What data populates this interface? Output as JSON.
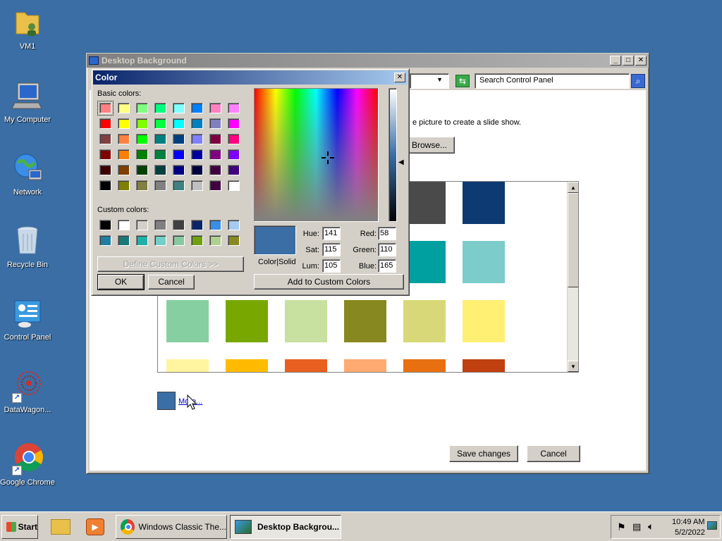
{
  "desktop": {
    "icons": [
      {
        "label": "VM1",
        "icon": "user-folder-icon"
      },
      {
        "label": "My Computer",
        "icon": "computer-icon"
      },
      {
        "label": "Network",
        "icon": "network-globe-icon"
      },
      {
        "label": "Recycle Bin",
        "icon": "recycle-bin-icon"
      },
      {
        "label": "Control Panel",
        "icon": "control-panel-icon"
      },
      {
        "label": "DataWagon...",
        "icon": "datawagon-icon"
      },
      {
        "label": "Google Chrome",
        "icon": "chrome-icon"
      }
    ]
  },
  "bg_window": {
    "title": "Desktop Background",
    "search_placeholder": "Search Control Panel",
    "instruction": "e picture to create a slide show.",
    "browse_label": "Browse...",
    "more_link": "More...",
    "selected_color": "#3a6ea5",
    "save_label": "Save changes",
    "cancel_label": "Cancel",
    "swatch_rows": [
      [
        "#ffffff",
        "#ffffff",
        "#ffffff",
        "#ffffff",
        "#4a4a4a",
        "#0d3a72"
      ],
      [
        "#ffffff",
        "#ffffff",
        "#ffffff",
        "#ffffff",
        "#00a0a0",
        "#7ccccc"
      ],
      [
        "#86cfa1",
        "#78a800",
        "#c8e0a0",
        "#888820",
        "#d8d878",
        "#fff074"
      ],
      [
        "#fff4a0",
        "#ffbb00",
        "#e86020",
        "#ffaa70",
        "#e87010",
        "#c04010"
      ]
    ]
  },
  "color_dialog": {
    "title": "Color",
    "basic_colors_label": "Basic colors:",
    "custom_colors_label": "Custom colors:",
    "define_custom_label": "Define Custom Colors >>",
    "ok_label": "OK",
    "cancel_label": "Cancel",
    "add_custom_label": "Add to Custom Colors",
    "color_solid_label": "Color|Solid",
    "current_color": "#3a6ea5",
    "basic_colors": [
      [
        "#ff8080",
        "#ffff80",
        "#80ff80",
        "#00ff80",
        "#80ffff",
        "#0080ff",
        "#ff80c0",
        "#ff80ff"
      ],
      [
        "#ff0000",
        "#ffff00",
        "#80ff00",
        "#00ff40",
        "#00ffff",
        "#0080c0",
        "#8080c0",
        "#ff00ff"
      ],
      [
        "#804040",
        "#ff8040",
        "#00ff00",
        "#008080",
        "#004080",
        "#8080ff",
        "#800040",
        "#ff0080"
      ],
      [
        "#800000",
        "#ff8000",
        "#008000",
        "#008040",
        "#0000ff",
        "#0000a0",
        "#800080",
        "#8000ff"
      ],
      [
        "#400000",
        "#804000",
        "#004000",
        "#004040",
        "#000080",
        "#000040",
        "#400040",
        "#400080"
      ],
      [
        "#000000",
        "#808000",
        "#808040",
        "#808080",
        "#408080",
        "#c0c0c0",
        "#400040",
        "#ffffff"
      ]
    ],
    "custom_colors": [
      [
        "#000000",
        "#ffffff",
        "#d4d0c8",
        "#808080",
        "#404040",
        "#0a246a",
        "#3a8ee6",
        "#a6caf0"
      ],
      [
        "#1e7fa0",
        "#1a7878",
        "#20b0a8",
        "#70d0c8",
        "#88c8a0",
        "#70a010",
        "#b0d090",
        "#888820"
      ]
    ],
    "fields": {
      "hue": {
        "label": "Hue:",
        "value": "141"
      },
      "sat": {
        "label": "Sat:",
        "value": "115"
      },
      "lum": {
        "label": "Lum:",
        "value": "105"
      },
      "red": {
        "label": "Red:",
        "value": "58"
      },
      "green": {
        "label": "Green:",
        "value": "110"
      },
      "blue": {
        "label": "Blue:",
        "value": "165"
      }
    }
  },
  "taskbar": {
    "start_label": "Start",
    "tasks": [
      {
        "label": "Windows Classic The...",
        "icon": "chrome-icon"
      },
      {
        "label": "Desktop Backgrou...",
        "icon": "desktop-background-icon"
      }
    ],
    "time": "10:49 AM",
    "date": "5/2/2022"
  }
}
